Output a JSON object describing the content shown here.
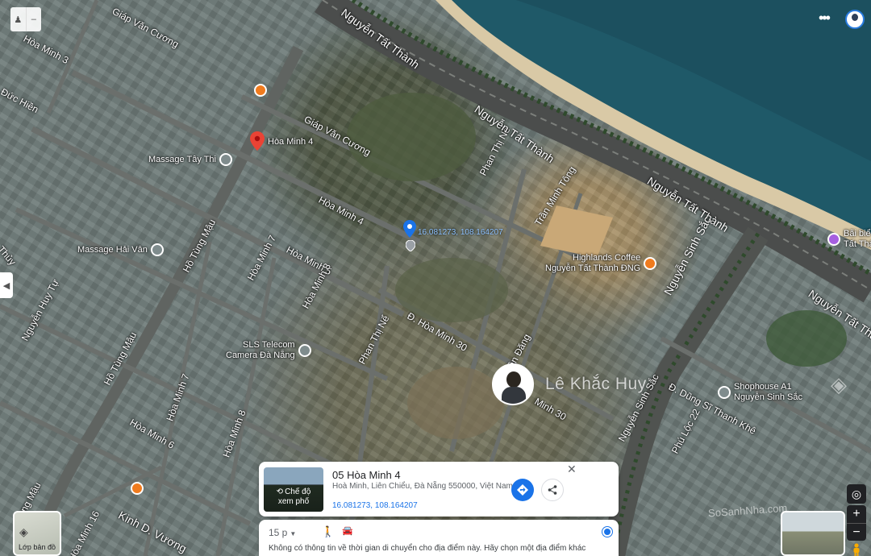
{
  "map": {
    "streets": [
      "Giáp Văn Cương",
      "Hòa Minh 3",
      "Đức Hiền",
      "Nguyễn Tất Thành",
      "Giáp Văn Cương",
      "Phan Thị Nể",
      "Hòa Minh 4",
      "Trần Minh Tông",
      "Nguyễn Tất Thành",
      "Hòa Minh 5",
      "Hồ Tùng Mậu",
      "Hòa Minh 7",
      "Hòa Minh 8",
      "Nguyễn Sinh Sắc",
      "Nguyễn Tất Thành",
      "Nguyễn Huy Tự",
      "Đ. Hòa Minh 30",
      "Phan Thị Nể",
      "Trần Đăng",
      "Hồ Tùng Mậu",
      "Hòa Minh 7",
      "Hòa Minh 8",
      "Hòa Minh 6",
      "Nguyễn Sinh Sắc",
      "Đ. Dũng Sĩ Thanh Khê",
      "Phú Lộc 22",
      "Kinh D. Vương",
      "Hòa Minh 16",
      "Tùng Mậu",
      "Minh 30",
      "Thủy"
    ],
    "pois": {
      "massage_tay_thi": "Massage Tây Thi",
      "massage_hai_van": "Massage Hải Vân",
      "sls_telecom_l1": "SLS Telecom",
      "sls_telecom_l2": "Camera Đà Nẵng",
      "highlands_l1": "Highlands Coffee",
      "highlands_l2": "Nguyễn Tất Thành ĐNG",
      "shophouse_l1": "Shophouse A1",
      "shophouse_l2": "Nguyễn Sinh Sắc",
      "beach_l1": "Bãi biể",
      "beach_l2": "Tất Thà"
    },
    "red_pin_label": "Hòa Minh 4",
    "blue_pin_label": "16.081273, 108.164207"
  },
  "watermark": {
    "name": "Lê Khắc Huy",
    "site": "SoSanhNha.com"
  },
  "card": {
    "thumb_label_l1": "Chế độ",
    "thumb_label_l2": "xem phố",
    "title": "05 Hòa Minh 4",
    "address": "Hoà Minh, Liên Chiểu, Đà Nẵng 550000, Việt Nam",
    "coords": "16.081273, 108.164207"
  },
  "directions": {
    "time": "15 p",
    "message": "Không có thông tin về thời gian di chuyển cho địa điểm này. Hãy chọn một địa điểm khác"
  },
  "layers_button": {
    "label": "Lớp bản đồ"
  },
  "icons": {
    "map_pin_red": "map-pin-icon",
    "map_pin_blue": "location-pin-icon",
    "directions": "directions-icon",
    "share": "share-icon",
    "close": "close-icon",
    "walking": "walking-icon",
    "car": "car-icon",
    "my_location": "my-location-icon",
    "zoom_in": "plus-icon",
    "zoom_out": "minus-icon",
    "pegman": "pegman-icon",
    "apps_menu": "more-vert-icon"
  },
  "colors": {
    "accent": "#1a73e8",
    "pin_red": "#ea4335",
    "poi_orange": "#f07b1e"
  }
}
